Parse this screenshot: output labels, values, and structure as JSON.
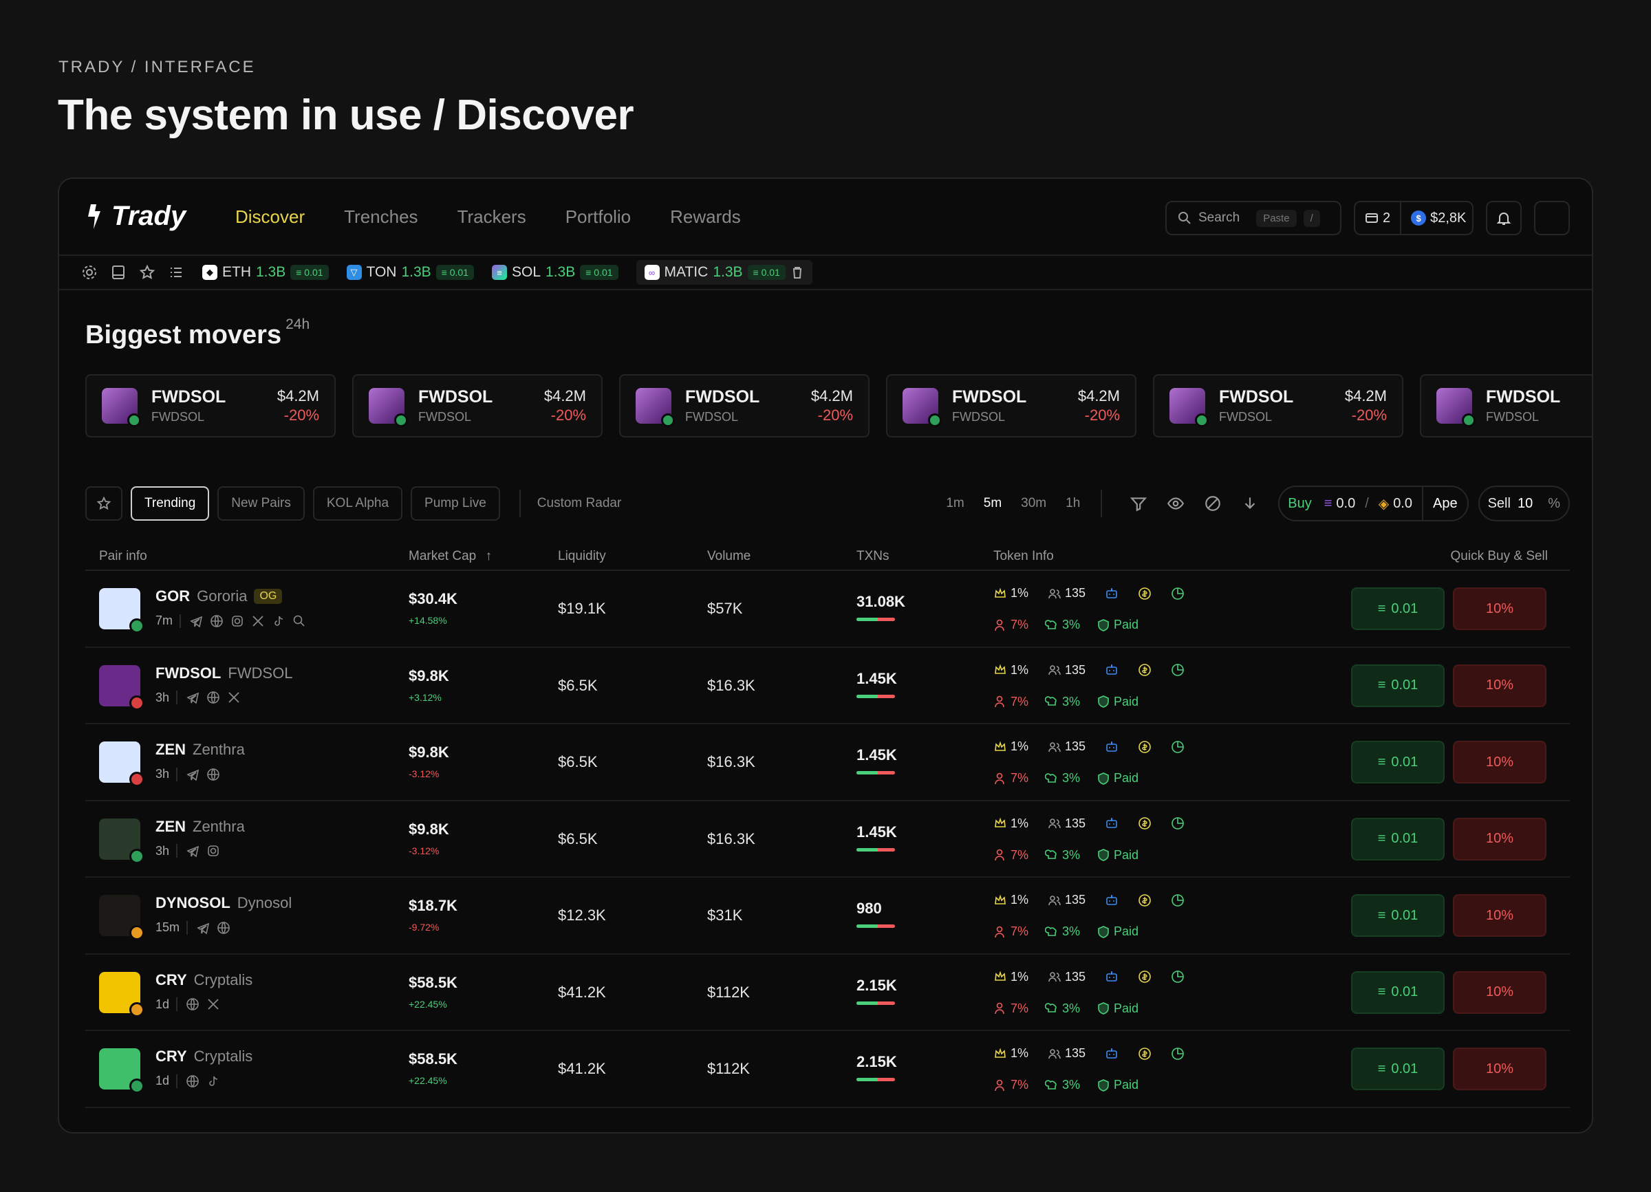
{
  "page": {
    "eyebrow": "TRADY / INTERFACE",
    "headline": "The system in use / Discover"
  },
  "app": {
    "brand": "Trady",
    "nav": [
      {
        "label": "Discover",
        "active": true
      },
      {
        "label": "Trenches"
      },
      {
        "label": "Trackers"
      },
      {
        "label": "Portfolio"
      },
      {
        "label": "Rewards"
      }
    ],
    "search": {
      "placeholder": "Search",
      "paste": "Paste",
      "shortcut": "/"
    },
    "wallet": {
      "count": "2",
      "balance": "$2,8K"
    },
    "tickers": [
      {
        "symbol": "ETH",
        "value": "1.3B",
        "badge": "0.01",
        "color": "#e0e0e0"
      },
      {
        "symbol": "TON",
        "value": "1.3B",
        "badge": "0.01",
        "color": "#2f8de4"
      },
      {
        "symbol": "SOL",
        "value": "1.3B",
        "badge": "0.01",
        "color": "#9b5de5"
      },
      {
        "symbol": "MATIC",
        "value": "1.3B",
        "badge": "0.01",
        "color": "#8247e5"
      }
    ]
  },
  "movers": {
    "title": "Biggest movers",
    "period": "24h",
    "cards": [
      {
        "name": "FWDSOL",
        "sub": "FWDSOL",
        "price": "$4.2M",
        "change": "-20%"
      },
      {
        "name": "FWDSOL",
        "sub": "FWDSOL",
        "price": "$4.2M",
        "change": "-20%"
      },
      {
        "name": "FWDSOL",
        "sub": "FWDSOL",
        "price": "$4.2M",
        "change": "-20%"
      },
      {
        "name": "FWDSOL",
        "sub": "FWDSOL",
        "price": "$4.2M",
        "change": "-20%"
      },
      {
        "name": "FWDSOL",
        "sub": "FWDSOL",
        "price": "$4.2M",
        "change": "-20%"
      },
      {
        "name": "FWDSOL",
        "sub": "FWDSOL",
        "price": "",
        "change": ""
      }
    ]
  },
  "filters": {
    "tabs": [
      "Trending",
      "New Pairs",
      "KOL Alpha",
      "Pump Live"
    ],
    "custom": "Custom Radar",
    "timeframes": [
      "1m",
      "5m",
      "30m",
      "1h"
    ],
    "activeTimeframe": "5m",
    "buy": {
      "label": "Buy",
      "sol": "0.0",
      "alt": "0.0",
      "sep": "/",
      "mode": "Ape"
    },
    "sell": {
      "label": "Sell",
      "value": "10",
      "unit": "%"
    }
  },
  "table": {
    "headers": {
      "pair": "Pair info",
      "mc": "Market Cap",
      "liq": "Liquidity",
      "vol": "Volume",
      "txns": "TXNs",
      "token": "Token Info",
      "quick": "Quick Buy & Sell"
    },
    "rows": [
      {
        "sym": "GOR",
        "full": "Gororia",
        "tag": "OG",
        "age": "7m",
        "mc": "$30.4K",
        "mcc": "+14.58%",
        "up": true,
        "liq": "$19.1K",
        "vol": "$57K",
        "tx": "31.08K",
        "avatar": "#d9e6ff",
        "dot": "#2ea05a"
      },
      {
        "sym": "FWDSOL",
        "full": "FWDSOL",
        "tag": "",
        "age": "3h",
        "mc": "$9.8K",
        "mcc": "+3.12%",
        "up": true,
        "liq": "$6.5K",
        "vol": "$16.3K",
        "tx": "1.45K",
        "avatar": "#6a2a8a",
        "dot": "#d94040"
      },
      {
        "sym": "ZEN",
        "full": "Zenthra",
        "tag": "",
        "age": "3h",
        "mc": "$9.8K",
        "mcc": "-3.12%",
        "up": false,
        "liq": "$6.5K",
        "vol": "$16.3K",
        "tx": "1.45K",
        "avatar": "#d9e6ff",
        "dot": "#d94040"
      },
      {
        "sym": "ZEN",
        "full": "Zenthra",
        "tag": "",
        "age": "3h",
        "mc": "$9.8K",
        "mcc": "-3.12%",
        "up": false,
        "liq": "$6.5K",
        "vol": "$16.3K",
        "tx": "1.45K",
        "avatar": "#2a3a2a",
        "dot": "#2ea05a"
      },
      {
        "sym": "DYNOSOL",
        "full": "Dynosol",
        "tag": "",
        "age": "15m",
        "mc": "$18.7K",
        "mcc": "-9.72%",
        "up": false,
        "liq": "$12.3K",
        "vol": "$31K",
        "tx": "980",
        "avatar": "#1c1a16",
        "dot": "#e89a20"
      },
      {
        "sym": "CRY",
        "full": "Cryptalis",
        "tag": "",
        "age": "1d",
        "mc": "$58.5K",
        "mcc": "+22.45%",
        "up": true,
        "liq": "$41.2K",
        "vol": "$112K",
        "tx": "2.15K",
        "avatar": "#f2c400",
        "dot": "#e89a20"
      },
      {
        "sym": "CRY",
        "full": "Cryptalis",
        "tag": "",
        "age": "1d",
        "mc": "$58.5K",
        "mcc": "+22.45%",
        "up": true,
        "liq": "$41.2K",
        "vol": "$112K",
        "tx": "2.15K",
        "avatar": "#3fbf6a",
        "dot": "#2ea05a"
      }
    ],
    "tokenInfo": {
      "top": "1%",
      "holders": "135",
      "dev": "7%",
      "snipers": "3%",
      "paid": "Paid"
    },
    "quickBuy": "0.01",
    "quickSell": "10%"
  }
}
